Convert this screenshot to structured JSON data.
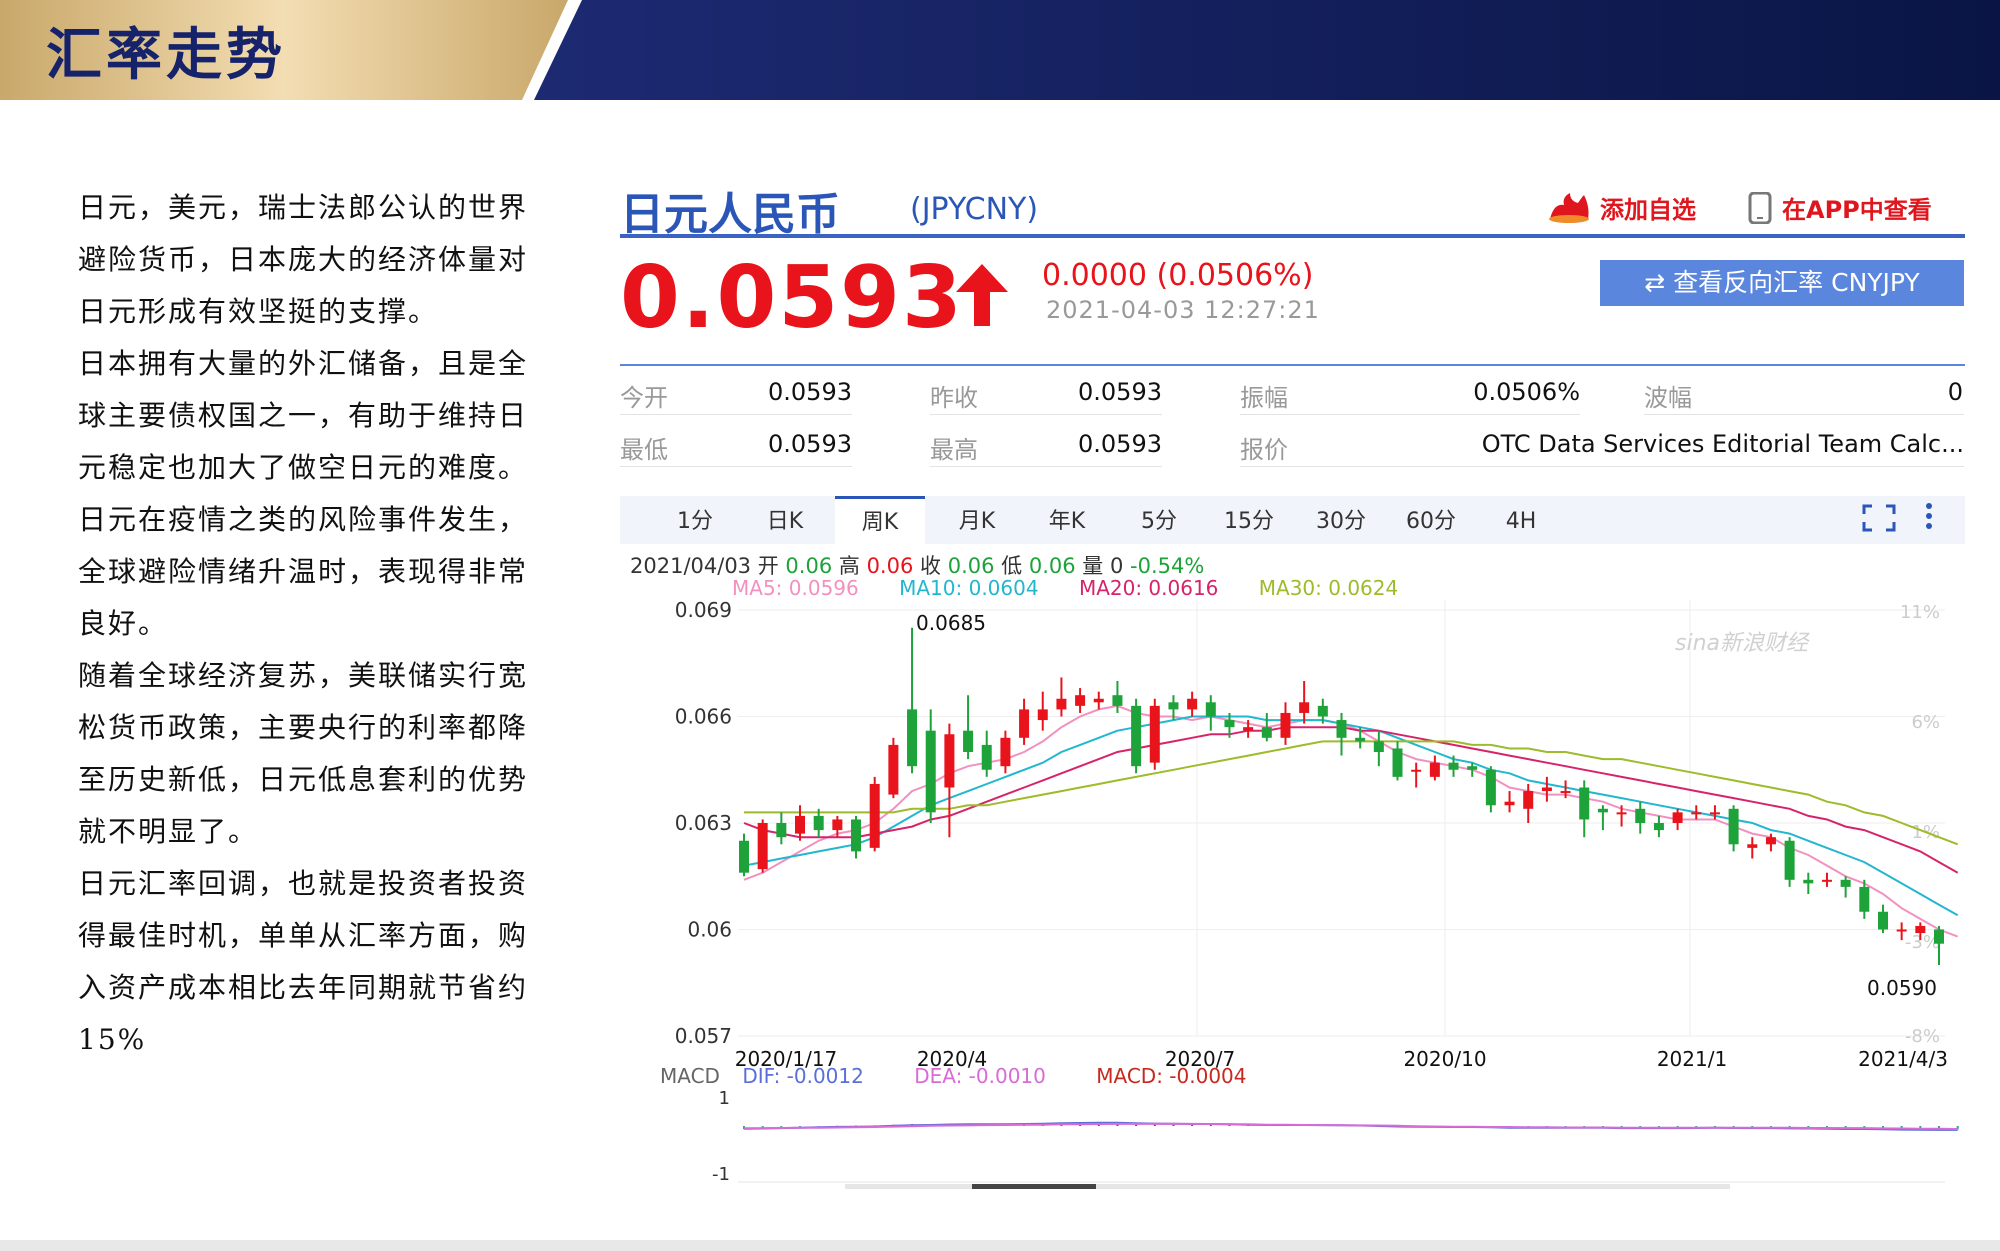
{
  "slide": {
    "title": "汇率走势",
    "paragraphs": [
      "日元，美元，瑞士法郎公认的世界避险货币，日本庞大的经济体量对日元形成有效坚挺的支撑。",
      "日本拥有大量的外汇储备，且是全球主要债权国之一，有助于维持日元稳定也加大了做空日元的难度。",
      "日元在疫情之类的风险事件发生，全球避险情绪升温时，表现得非常良好。",
      "随着全球经济复苏，美联储实行宽松货币政策，主要央行的利率都降至历史新低，日元低息套利的优势就不明显了。",
      "日元汇率回调，也就是投资者投资得最佳时机，单单从汇率方面，购入资产成本相比去年同期就节省约15%"
    ]
  },
  "quote": {
    "name": "日元人民币",
    "code": "(JPYCNY)",
    "add_watch": "添加自选",
    "view_app": "在APP中查看",
    "price": "0.0593",
    "change": "0.0000 (0.0506%)",
    "timestamp": "2021-04-03 12:27:21",
    "reverse_button": "⇄ 查看反向汇率 CNYJPY",
    "colors": {
      "up": "#e8131b",
      "down": "#1ea23a",
      "accent": "#2a56b8"
    }
  },
  "stats": {
    "open_label": "今开",
    "open": "0.0593",
    "prev_close_label": "昨收",
    "prev_close": "0.0593",
    "amplitude_label": "振幅",
    "amplitude": "0.0506%",
    "wave_label": "波幅",
    "wave": "0",
    "low_label": "最低",
    "low": "0.0593",
    "high_label": "最高",
    "high": "0.0593",
    "quote_label": "报价",
    "quote_src": "OTC Data Services Editorial Team Calc..."
  },
  "tabs": [
    "1分",
    "日K",
    "周K",
    "月K",
    "年K",
    "5分",
    "15分",
    "30分",
    "60分",
    "4H"
  ],
  "active_tab": "周K",
  "info": {
    "date": "2021/04/03",
    "open_label": "开",
    "open": "0.06",
    "high_label": "高",
    "high": "0.06",
    "close_label": "收",
    "close": "0.06",
    "low_label": "低",
    "low": "0.06",
    "vol_label": "量",
    "vol": "0",
    "pct": "-0.54%"
  },
  "ma": {
    "ma5": "MA5: 0.0596",
    "ma10": "MA10: 0.0604",
    "ma20": "MA20: 0.0616",
    "ma30": "MA30: 0.0624",
    "colors": {
      "ma5": "#f291c0",
      "ma10": "#22b7cf",
      "ma20": "#d6246a",
      "ma30": "#9dbb2a"
    }
  },
  "macd": {
    "label": "MACD",
    "dif": "DIF: -0.0012",
    "dea": "DEA: -0.0010",
    "macd": "MACD: -0.0004",
    "yticks": [
      "1",
      "-1"
    ]
  },
  "watermark": "sina新浪财经",
  "chart_data": {
    "type": "candlestick",
    "title": "",
    "ylim": [
      0.057,
      0.069
    ],
    "yticks": [
      "0.069",
      "0.066",
      "0.063",
      "0.06",
      "0.057"
    ],
    "pct_ticks": [
      "11%",
      "6%",
      "1%",
      "-3%",
      "-8%"
    ],
    "x_ticks": [
      "2020/1/17",
      "2020/4",
      "2020/7",
      "2020/10",
      "2021/1",
      "2021/4/3"
    ],
    "annotations": {
      "max": "0.0685",
      "min": "0.0590"
    },
    "candles": [
      {
        "o": 0.0625,
        "c": 0.0616,
        "h": 0.0627,
        "l": 0.0615
      },
      {
        "o": 0.0617,
        "c": 0.063,
        "h": 0.0631,
        "l": 0.0616
      },
      {
        "o": 0.063,
        "c": 0.0626,
        "h": 0.0633,
        "l": 0.0624
      },
      {
        "o": 0.0627,
        "c": 0.0632,
        "h": 0.0635,
        "l": 0.0625
      },
      {
        "o": 0.0632,
        "c": 0.0628,
        "h": 0.0634,
        "l": 0.0626
      },
      {
        "o": 0.0628,
        "c": 0.0631,
        "h": 0.0632,
        "l": 0.0626
      },
      {
        "o": 0.0631,
        "c": 0.0622,
        "h": 0.0632,
        "l": 0.062
      },
      {
        "o": 0.0623,
        "c": 0.0641,
        "h": 0.0643,
        "l": 0.0622
      },
      {
        "o": 0.0638,
        "c": 0.0652,
        "h": 0.0654,
        "l": 0.0637
      },
      {
        "o": 0.0662,
        "c": 0.0646,
        "h": 0.0685,
        "l": 0.0644
      },
      {
        "o": 0.0656,
        "c": 0.0633,
        "h": 0.0662,
        "l": 0.063
      },
      {
        "o": 0.064,
        "c": 0.0655,
        "h": 0.0658,
        "l": 0.0626
      },
      {
        "o": 0.0656,
        "c": 0.065,
        "h": 0.0666,
        "l": 0.0648
      },
      {
        "o": 0.0652,
        "c": 0.0645,
        "h": 0.0656,
        "l": 0.0643
      },
      {
        "o": 0.0646,
        "c": 0.0654,
        "h": 0.0656,
        "l": 0.0644
      },
      {
        "o": 0.0654,
        "c": 0.0662,
        "h": 0.0665,
        "l": 0.0652
      },
      {
        "o": 0.0659,
        "c": 0.0662,
        "h": 0.0667,
        "l": 0.0656
      },
      {
        "o": 0.0662,
        "c": 0.0665,
        "h": 0.0671,
        "l": 0.066
      },
      {
        "o": 0.0663,
        "c": 0.0666,
        "h": 0.0668,
        "l": 0.0661
      },
      {
        "o": 0.0664,
        "c": 0.0665,
        "h": 0.0667,
        "l": 0.0662
      },
      {
        "o": 0.0666,
        "c": 0.0663,
        "h": 0.067,
        "l": 0.0661
      },
      {
        "o": 0.0663,
        "c": 0.0646,
        "h": 0.0665,
        "l": 0.0644
      },
      {
        "o": 0.0647,
        "c": 0.0663,
        "h": 0.0665,
        "l": 0.0645
      },
      {
        "o": 0.0664,
        "c": 0.0662,
        "h": 0.0666,
        "l": 0.0659
      },
      {
        "o": 0.0662,
        "c": 0.0665,
        "h": 0.0667,
        "l": 0.066
      },
      {
        "o": 0.0664,
        "c": 0.066,
        "h": 0.0666,
        "l": 0.0656
      },
      {
        "o": 0.0659,
        "c": 0.0657,
        "h": 0.0661,
        "l": 0.0654
      },
      {
        "o": 0.0656,
        "c": 0.0657,
        "h": 0.0659,
        "l": 0.0654
      },
      {
        "o": 0.0657,
        "c": 0.0654,
        "h": 0.0661,
        "l": 0.0653
      },
      {
        "o": 0.0654,
        "c": 0.0661,
        "h": 0.0664,
        "l": 0.0652
      },
      {
        "o": 0.0661,
        "c": 0.0664,
        "h": 0.067,
        "l": 0.0658
      },
      {
        "o": 0.0663,
        "c": 0.066,
        "h": 0.0665,
        "l": 0.0658
      },
      {
        "o": 0.0659,
        "c": 0.0654,
        "h": 0.0661,
        "l": 0.0649
      },
      {
        "o": 0.0654,
        "c": 0.0653,
        "h": 0.0657,
        "l": 0.0651
      },
      {
        "o": 0.0653,
        "c": 0.065,
        "h": 0.0656,
        "l": 0.0646
      },
      {
        "o": 0.0651,
        "c": 0.0643,
        "h": 0.0653,
        "l": 0.0642
      },
      {
        "o": 0.0645,
        "c": 0.0645,
        "h": 0.0647,
        "l": 0.064
      },
      {
        "o": 0.0643,
        "c": 0.0647,
        "h": 0.0649,
        "l": 0.0642
      },
      {
        "o": 0.0647,
        "c": 0.0645,
        "h": 0.0649,
        "l": 0.0643
      },
      {
        "o": 0.0646,
        "c": 0.0645,
        "h": 0.0647,
        "l": 0.0643
      },
      {
        "o": 0.0645,
        "c": 0.0635,
        "h": 0.0646,
        "l": 0.0633
      },
      {
        "o": 0.0635,
        "c": 0.0636,
        "h": 0.0639,
        "l": 0.0633
      },
      {
        "o": 0.0634,
        "c": 0.0639,
        "h": 0.0641,
        "l": 0.063
      },
      {
        "o": 0.0639,
        "c": 0.064,
        "h": 0.0643,
        "l": 0.0636
      },
      {
        "o": 0.0639,
        "c": 0.0639,
        "h": 0.0642,
        "l": 0.0637
      },
      {
        "o": 0.064,
        "c": 0.0631,
        "h": 0.0642,
        "l": 0.0626
      },
      {
        "o": 0.0634,
        "c": 0.0633,
        "h": 0.0635,
        "l": 0.0628
      },
      {
        "o": 0.0633,
        "c": 0.0633,
        "h": 0.0635,
        "l": 0.0629
      },
      {
        "o": 0.0634,
        "c": 0.063,
        "h": 0.0636,
        "l": 0.0627
      },
      {
        "o": 0.063,
        "c": 0.0628,
        "h": 0.0632,
        "l": 0.0626
      },
      {
        "o": 0.063,
        "c": 0.0633,
        "h": 0.0634,
        "l": 0.0628
      },
      {
        "o": 0.0633,
        "c": 0.0633,
        "h": 0.0635,
        "l": 0.0631
      },
      {
        "o": 0.0633,
        "c": 0.0633,
        "h": 0.0635,
        "l": 0.0631
      },
      {
        "o": 0.0634,
        "c": 0.0624,
        "h": 0.0635,
        "l": 0.0622
      },
      {
        "o": 0.0623,
        "c": 0.0624,
        "h": 0.0626,
        "l": 0.062
      },
      {
        "o": 0.0624,
        "c": 0.0626,
        "h": 0.0627,
        "l": 0.0622
      },
      {
        "o": 0.0625,
        "c": 0.0614,
        "h": 0.0626,
        "l": 0.0612
      },
      {
        "o": 0.0614,
        "c": 0.0613,
        "h": 0.0616,
        "l": 0.061
      },
      {
        "o": 0.0614,
        "c": 0.0614,
        "h": 0.0616,
        "l": 0.0612
      },
      {
        "o": 0.0614,
        "c": 0.0612,
        "h": 0.0615,
        "l": 0.0609
      },
      {
        "o": 0.0612,
        "c": 0.0605,
        "h": 0.0614,
        "l": 0.0603
      },
      {
        "o": 0.0605,
        "c": 0.06,
        "h": 0.0607,
        "l": 0.0599
      },
      {
        "o": 0.06,
        "c": 0.06,
        "h": 0.0602,
        "l": 0.0597
      },
      {
        "o": 0.0599,
        "c": 0.0601,
        "h": 0.0602,
        "l": 0.0597
      },
      {
        "o": 0.06,
        "c": 0.0596,
        "h": 0.0601,
        "l": 0.059
      }
    ],
    "series": [
      {
        "name": "MA5",
        "values": [
          0.0614,
          0.0616,
          0.0619,
          0.0622,
          0.0625,
          0.0627,
          0.0628,
          0.063,
          0.0634,
          0.0639,
          0.0641,
          0.0644,
          0.0646,
          0.0647,
          0.0648,
          0.065,
          0.0653,
          0.0657,
          0.066,
          0.0662,
          0.0663,
          0.0661,
          0.066,
          0.066,
          0.0659,
          0.066,
          0.0659,
          0.0658,
          0.0657,
          0.0658,
          0.0659,
          0.0659,
          0.0658,
          0.0656,
          0.0653,
          0.065,
          0.0648,
          0.0647,
          0.0646,
          0.0645,
          0.0643,
          0.064,
          0.0639,
          0.0638,
          0.0638,
          0.0637,
          0.0636,
          0.0634,
          0.0633,
          0.0632,
          0.0631,
          0.0631,
          0.0631,
          0.0629,
          0.0627,
          0.0626,
          0.0623,
          0.0621,
          0.0618,
          0.0615,
          0.0613,
          0.061,
          0.0606,
          0.0603,
          0.06,
          0.0598
        ]
      },
      {
        "name": "MA10",
        "values": [
          0.0618,
          0.0619,
          0.062,
          0.0621,
          0.0622,
          0.0623,
          0.0624,
          0.0626,
          0.0629,
          0.0632,
          0.0635,
          0.0637,
          0.0639,
          0.0641,
          0.0643,
          0.0645,
          0.0647,
          0.065,
          0.0652,
          0.0654,
          0.0656,
          0.0657,
          0.0658,
          0.0659,
          0.066,
          0.066,
          0.066,
          0.066,
          0.0659,
          0.0659,
          0.0659,
          0.0659,
          0.0658,
          0.0657,
          0.0656,
          0.0654,
          0.0652,
          0.065,
          0.0648,
          0.0647,
          0.0645,
          0.0644,
          0.0642,
          0.0641,
          0.064,
          0.0639,
          0.0638,
          0.0637,
          0.0636,
          0.0635,
          0.0634,
          0.0633,
          0.0632,
          0.0631,
          0.063,
          0.0628,
          0.0627,
          0.0625,
          0.0623,
          0.0621,
          0.0619,
          0.0616,
          0.0613,
          0.061,
          0.0607,
          0.0604
        ]
      },
      {
        "name": "MA20",
        "values": [
          0.063,
          0.0628,
          0.0627,
          0.0626,
          0.0626,
          0.0626,
          0.0626,
          0.0627,
          0.0628,
          0.0629,
          0.0631,
          0.0632,
          0.0634,
          0.0636,
          0.0638,
          0.064,
          0.0642,
          0.0644,
          0.0646,
          0.0648,
          0.065,
          0.0651,
          0.0652,
          0.0653,
          0.0654,
          0.0655,
          0.0655,
          0.0656,
          0.0656,
          0.0657,
          0.0657,
          0.0657,
          0.0657,
          0.0656,
          0.0656,
          0.0655,
          0.0654,
          0.0653,
          0.0652,
          0.0651,
          0.065,
          0.0649,
          0.0648,
          0.0647,
          0.0646,
          0.0645,
          0.0644,
          0.0643,
          0.0642,
          0.0641,
          0.064,
          0.0639,
          0.0638,
          0.0637,
          0.0636,
          0.0635,
          0.0634,
          0.0632,
          0.0631,
          0.0629,
          0.0628,
          0.0626,
          0.0624,
          0.0622,
          0.0619,
          0.0616
        ]
      },
      {
        "name": "MA30",
        "values": [
          0.0633,
          0.0633,
          0.0633,
          0.0633,
          0.0633,
          0.0633,
          0.0633,
          0.0633,
          0.0633,
          0.0634,
          0.0634,
          0.0634,
          0.0635,
          0.0635,
          0.0636,
          0.0637,
          0.0638,
          0.0639,
          0.064,
          0.0641,
          0.0642,
          0.0643,
          0.0644,
          0.0645,
          0.0646,
          0.0647,
          0.0648,
          0.0649,
          0.065,
          0.0651,
          0.0652,
          0.0653,
          0.0653,
          0.0653,
          0.0653,
          0.0653,
          0.0653,
          0.0653,
          0.0653,
          0.0652,
          0.0652,
          0.0651,
          0.0651,
          0.065,
          0.065,
          0.0649,
          0.0648,
          0.0648,
          0.0647,
          0.0646,
          0.0645,
          0.0644,
          0.0643,
          0.0642,
          0.0641,
          0.064,
          0.0639,
          0.0638,
          0.0636,
          0.0635,
          0.0633,
          0.0632,
          0.063,
          0.0628,
          0.0626,
          0.0624
        ]
      }
    ]
  }
}
